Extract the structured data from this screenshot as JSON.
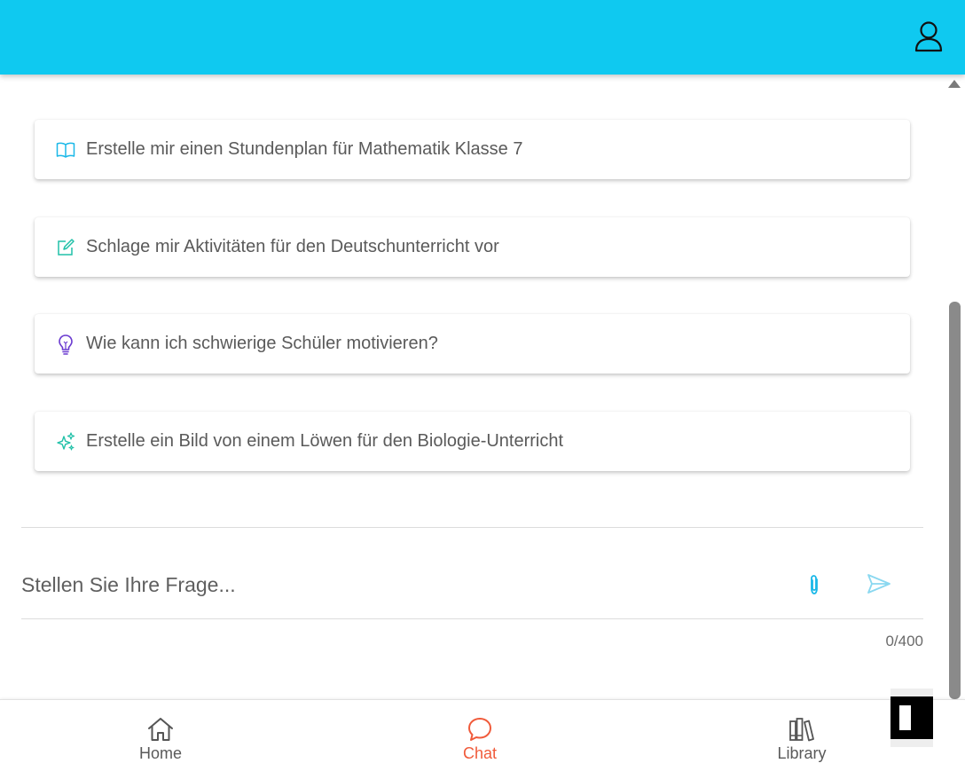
{
  "header": {
    "profile_icon": "user-icon",
    "color": "#0fc9f0"
  },
  "suggestions": [
    {
      "icon": "book-icon",
      "label": "Erstelle mir einen Stundenplan für Mathematik Klasse 7",
      "color": "#1ab8e8"
    },
    {
      "icon": "edit-icon",
      "label": "Schlage mir Aktivitäten für den Deutschunterricht vor",
      "color": "#20c0a8"
    },
    {
      "icon": "lightbulb-icon",
      "label": "Wie kann ich schwierige Schüler motivieren?",
      "color": "#6a3ad0"
    },
    {
      "icon": "sparkles-icon",
      "label": "Erstelle ein Bild von einem Löwen für den Biologie-Unterricht",
      "color": "#20c0a8"
    }
  ],
  "input": {
    "placeholder": "Stellen Sie Ihre Frage...",
    "value": "",
    "counter": "0/400"
  },
  "nav": {
    "home": "Home",
    "chat": "Chat",
    "library": "Library",
    "active": "chat",
    "active_color": "#f05a3a"
  }
}
